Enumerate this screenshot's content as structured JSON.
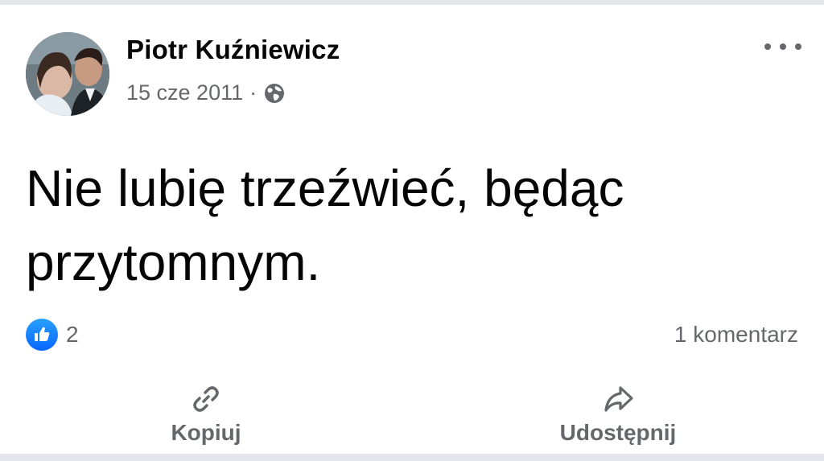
{
  "post": {
    "author": "Piotr Kuźniewicz",
    "date": "15 cze 2011",
    "separator": "·",
    "privacy_icon": "globe-icon",
    "text": "Nie lubię trzeźwieć, będąc przytomnym.",
    "reactions_count": "2",
    "comments_label": "1 komentarz"
  },
  "actions": {
    "copy_label": "Kopiuj",
    "share_label": "Udostępnij"
  },
  "colors": {
    "accent": "#0866ff",
    "secondary_text": "#65676b",
    "primary_text": "#050505"
  }
}
